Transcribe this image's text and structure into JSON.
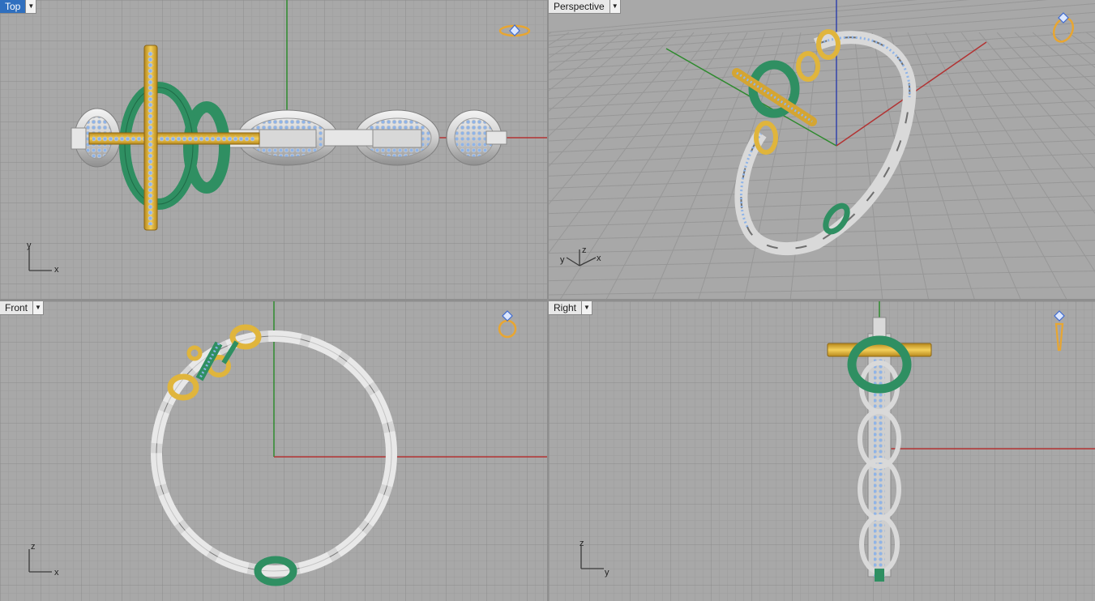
{
  "viewports": {
    "top": {
      "label": "Top",
      "axis_h": "x",
      "axis_v": "y"
    },
    "perspective": {
      "label": "Perspective",
      "axis_a": "x",
      "axis_b": "y",
      "axis_c": "z"
    },
    "front": {
      "label": "Front",
      "axis_h": "x",
      "axis_v": "z"
    },
    "right": {
      "label": "Right",
      "axis_h": "y",
      "axis_v": "z"
    }
  },
  "icons": {
    "dropdown": "triangle-down",
    "ring_widget": "ring-with-diamond"
  },
  "colors": {
    "viewport_bg": "#a8a8a8",
    "grid_minor": "#9b9b9b",
    "grid_major": "#8a8a8a",
    "axis_x": "#b23333",
    "axis_y": "#2e8a2e",
    "axis_z": "#3344aa",
    "active_tab": "#2f6fbf",
    "gold": "#e0b53c",
    "silver": "#d4d4d4",
    "green": "#2f8f62",
    "gem": "#8fb4e8"
  }
}
